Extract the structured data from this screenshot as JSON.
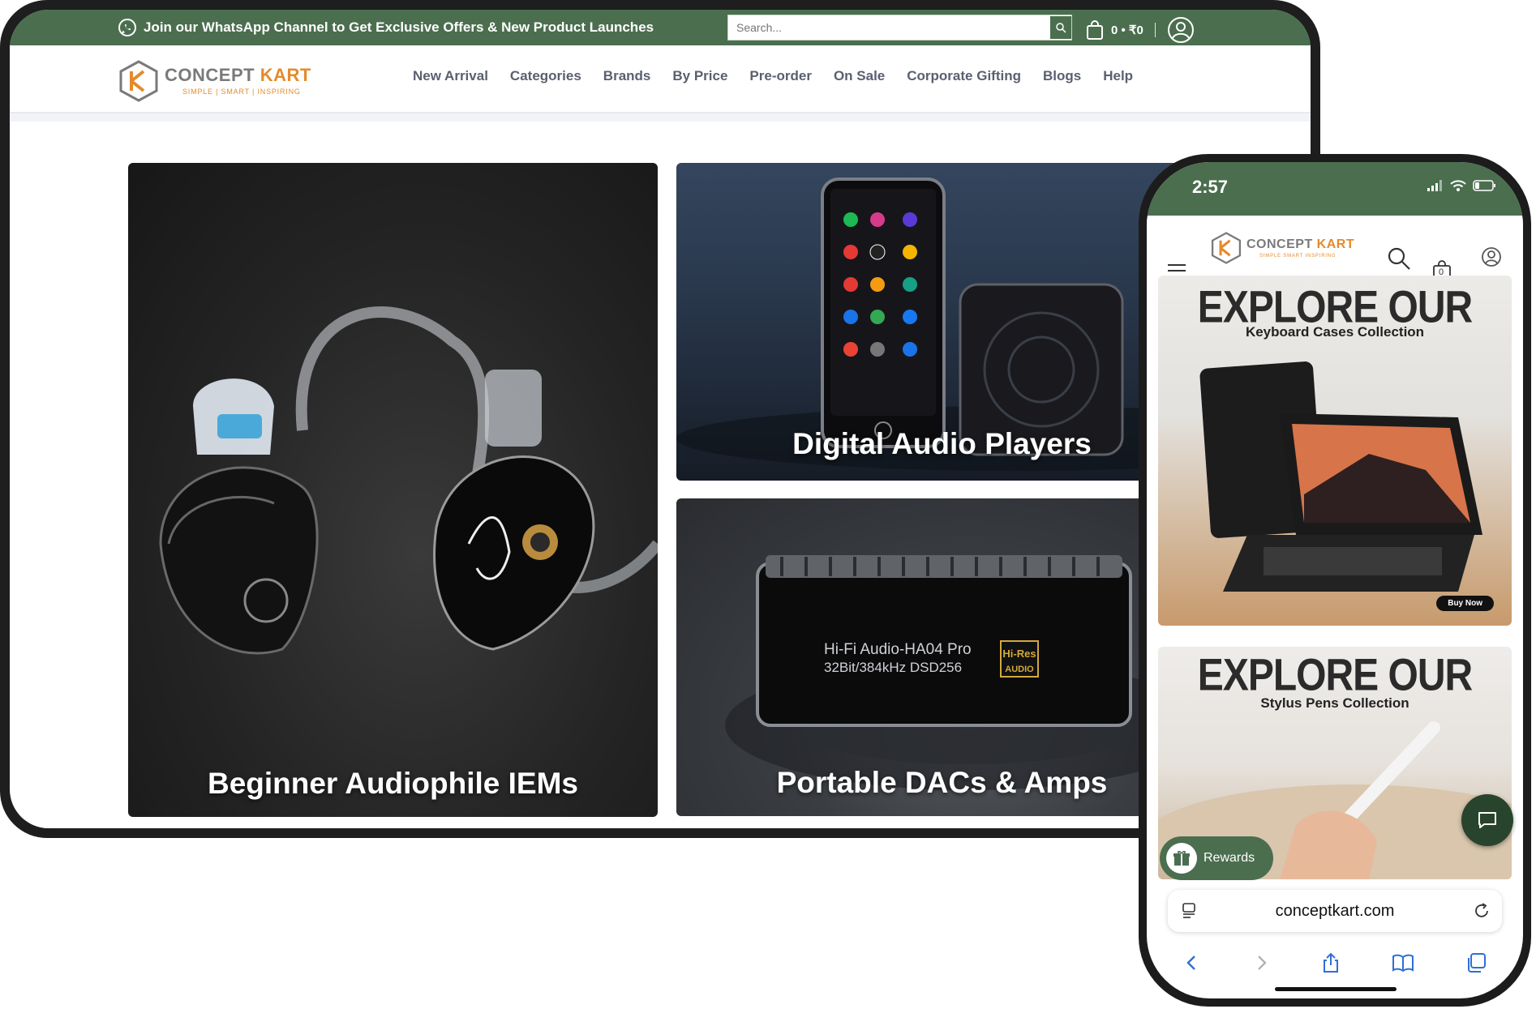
{
  "desktop": {
    "topbar": {
      "whatsapp_text": "Join our WhatsApp Channel to Get Exclusive Offers & New Product Launches",
      "search_placeholder": "Search...",
      "cart_summary": "0 • ₹0"
    },
    "logo": {
      "name_part1": "CONCEPT ",
      "name_part2": "KART",
      "tagline": "SIMPLE | SMART | INSPIRING"
    },
    "nav": [
      "New Arrival",
      "Categories",
      "Brands",
      "By Price",
      "Pre-order",
      "On Sale",
      "Corporate Gifting",
      "Blogs",
      "Help"
    ],
    "tiles": [
      {
        "label": "Beginner Audiophile IEMs"
      },
      {
        "label": "Digital Audio Players"
      },
      {
        "label": "Portable DACs & Amps",
        "product_text_1": "Hi-Fi Audio-HA04 Pro",
        "product_text_2": "32Bit/384kHz DSD256",
        "badge_top": "Hi-Res",
        "badge_bottom": "AUDIO"
      }
    ]
  },
  "phone": {
    "time": "2:57",
    "logo": {
      "name_part1": "CONCEPT ",
      "name_part2": "KART",
      "tagline": "SIMPLE SMART INSPIRING"
    },
    "cart_count": "0",
    "banners": [
      {
        "title": "EXPLORE OUR",
        "subtitle": "Keyboard Cases Collection",
        "cta": "Buy Now"
      },
      {
        "title": "EXPLORE OUR",
        "subtitle": "Stylus Pens Collection"
      }
    ],
    "rewards_label": "Rewards",
    "url": "conceptkart.com"
  },
  "colors": {
    "brand_green": "#4b6e4f",
    "brand_orange": "#e58a2c",
    "dark_green": "#29442c"
  }
}
